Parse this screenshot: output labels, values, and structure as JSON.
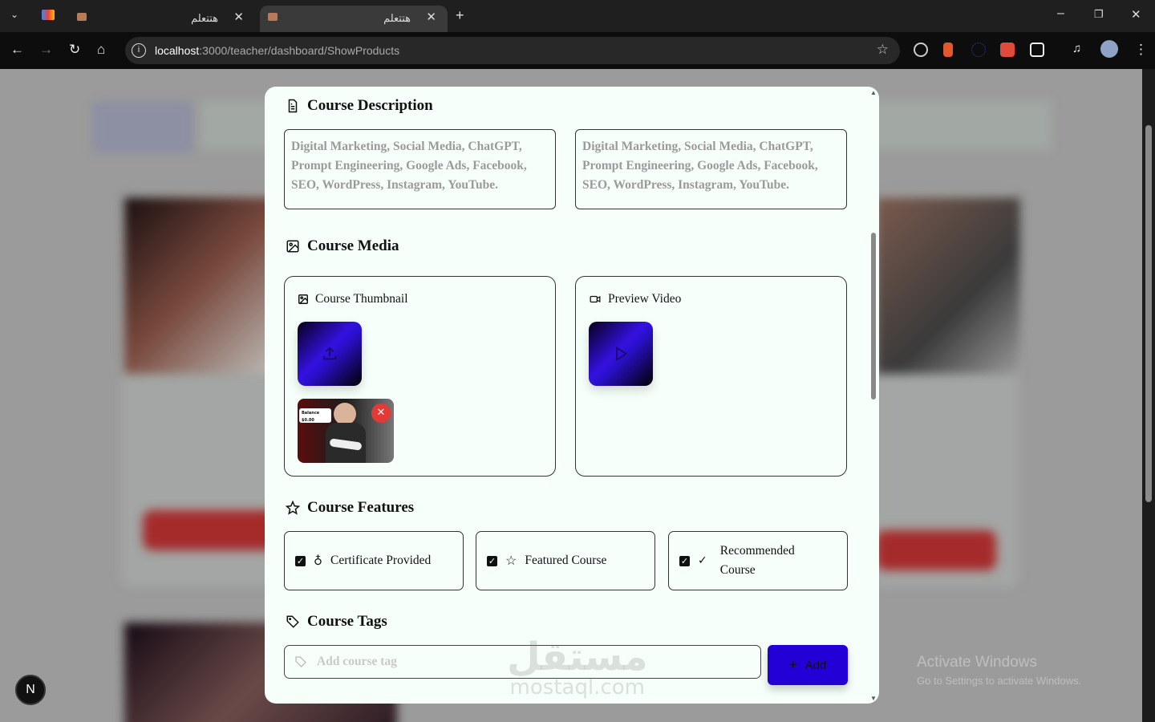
{
  "browser": {
    "tabs": [
      {
        "title": "هتتعلم",
        "active": false
      },
      {
        "title": "هتتعلم",
        "active": true
      }
    ],
    "url_host": "localhost",
    "url_path": ":3000/teacher/dashboard/ShowProducts"
  },
  "modal": {
    "description": {
      "heading": "Course Description",
      "fields": [
        "Digital Marketing, Social Media, ChatGPT, Prompt Engineering, Google Ads, Facebook, SEO, WordPress, Instagram, YouTube.",
        "Digital Marketing, Social Media, ChatGPT, Prompt Engineering, Google Ads, Facebook, SEO, WordPress, Instagram, YouTube."
      ]
    },
    "media": {
      "heading": "Course Media",
      "thumbnail_label": "Course Thumbnail",
      "thumbnail_image_text": "Balance $0.00",
      "video_label": "Preview Video"
    },
    "features": {
      "heading": "Course Features",
      "items": [
        {
          "label": "Certificate Provided",
          "checked": true,
          "icon": "award-icon"
        },
        {
          "label": "Featured Course",
          "checked": true,
          "icon": "star-icon"
        },
        {
          "label": "Recommended Course",
          "checked": true,
          "icon": "check-icon"
        }
      ]
    },
    "tags": {
      "heading": "Course Tags",
      "placeholder": "Add course tag",
      "add_label": "Add"
    }
  },
  "overlay": {
    "watermark_ar": "مستقل",
    "watermark": "mostaql.com",
    "windows_title": "Activate Windows",
    "windows_sub": "Go to Settings to activate Windows.",
    "dev_badge": "N"
  },
  "colors": {
    "accent": "#2200d6",
    "modal_bg": "#f6fff9",
    "remove": "#e53935"
  }
}
